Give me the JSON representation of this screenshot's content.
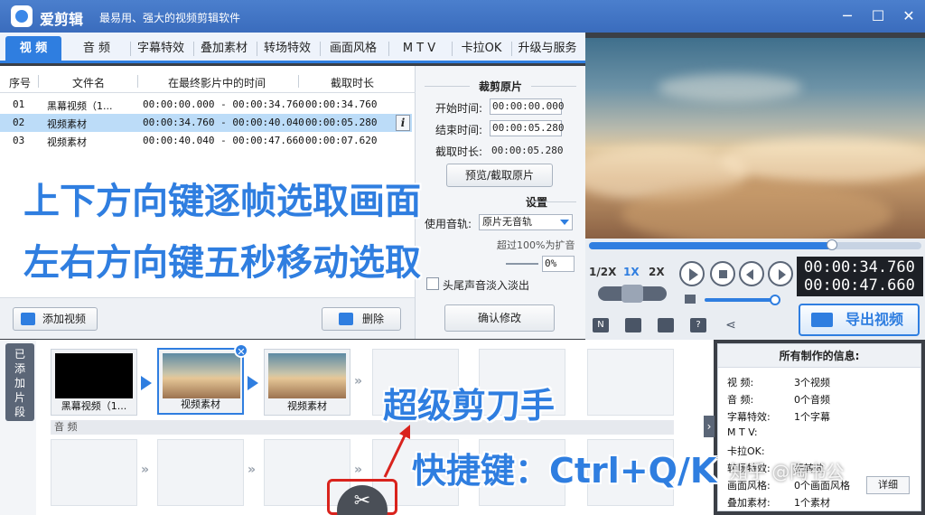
{
  "window": {
    "app_name": "爱剪辑",
    "slogan": "最易用、强大的视频剪辑软件",
    "minimize_icon": "minimize-icon",
    "maximize_icon": "maximize-icon",
    "close_icon": "close-icon"
  },
  "tabs": [
    {
      "label": "视 频",
      "active": true
    },
    {
      "label": "音 频"
    },
    {
      "label": "字幕特效"
    },
    {
      "label": "叠加素材"
    },
    {
      "label": "转场特效"
    },
    {
      "label": "画面风格"
    },
    {
      "label": "M T V"
    },
    {
      "label": "卡拉OK"
    },
    {
      "label": "升级与服务"
    }
  ],
  "clip_table": {
    "headers": [
      "序号",
      "文件名",
      "在最终影片中的时间",
      "截取时长"
    ],
    "rows": [
      {
        "index": "01",
        "name": "黑幕视频（1...",
        "time": "00:00:00.000 - 00:00:34.760",
        "duration": "00:00:34.760"
      },
      {
        "index": "02",
        "name": "视频素材",
        "time": "00:00:34.760 - 00:00:40.040",
        "duration": "00:00:05.280",
        "selected": true
      },
      {
        "index": "03",
        "name": "视频素材",
        "time": "00:00:40.040 - 00:00:47.660",
        "duration": "00:00:07.620"
      }
    ],
    "info_icon": "i"
  },
  "overlay": {
    "line1": "上下方向键逐帧选取画面",
    "line2": "左右方向键五秒移动选取",
    "line3": "超级剪刀手",
    "line4": "快捷键：Ctrl+Q/K"
  },
  "buttons": {
    "add_video": "添加视频",
    "delete": "删除",
    "confirm": "确认修改",
    "pick_clip": "预览/截取原片",
    "export": "导出视频",
    "detail": "详细"
  },
  "trim": {
    "title": "裁剪原片",
    "start_label": "开始时间:",
    "start_value": "00:00:00.000",
    "end_label": "结束时间:",
    "end_value": "00:00:05.280",
    "length_label": "截取时长:",
    "length_value": "00:00:05.280",
    "settings_title": "设置",
    "track_label": "使用音轨:",
    "track_value": "原片无音轨",
    "volume_note": "超过100%为扩音",
    "volume_value": "0%",
    "fade_label": "头尾声音淡入淡出"
  },
  "player": {
    "progress": 0.73,
    "speeds": [
      "1/2X",
      "1X",
      "2X"
    ],
    "active_speed": "1X",
    "time_current": "00:00:34.760",
    "time_total": "00:00:47.660"
  },
  "timeline": {
    "label": "已添加片段",
    "clips": [
      {
        "name": "黑幕视频（1...",
        "thumb": "black"
      },
      {
        "name": "视频素材",
        "thumb": "sky",
        "selected": true
      },
      {
        "name": "视频素材",
        "thumb": "sky"
      }
    ],
    "audio_label": "音 频"
  },
  "info": {
    "title": "所有制作的信息:",
    "rows": [
      {
        "label": "视    频:",
        "value": "3个视频"
      },
      {
        "label": "音    频:",
        "value": "0个音频"
      },
      {
        "label": "字幕特效:",
        "value": "1个字幕"
      },
      {
        "label": "M  T  V:",
        "value": ""
      },
      {
        "label": "卡拉OK:",
        "value": ""
      },
      {
        "label": "转场特效:",
        "value": "无转效"
      },
      {
        "label": "画面风格:",
        "value": "0个画面风格"
      },
      {
        "label": "叠加素材:",
        "value": "1个素材"
      }
    ]
  },
  "watermark": "知乎 @陶书公",
  "colors": {
    "accent": "#2f7ee0",
    "highlight_red": "#d9231d"
  }
}
